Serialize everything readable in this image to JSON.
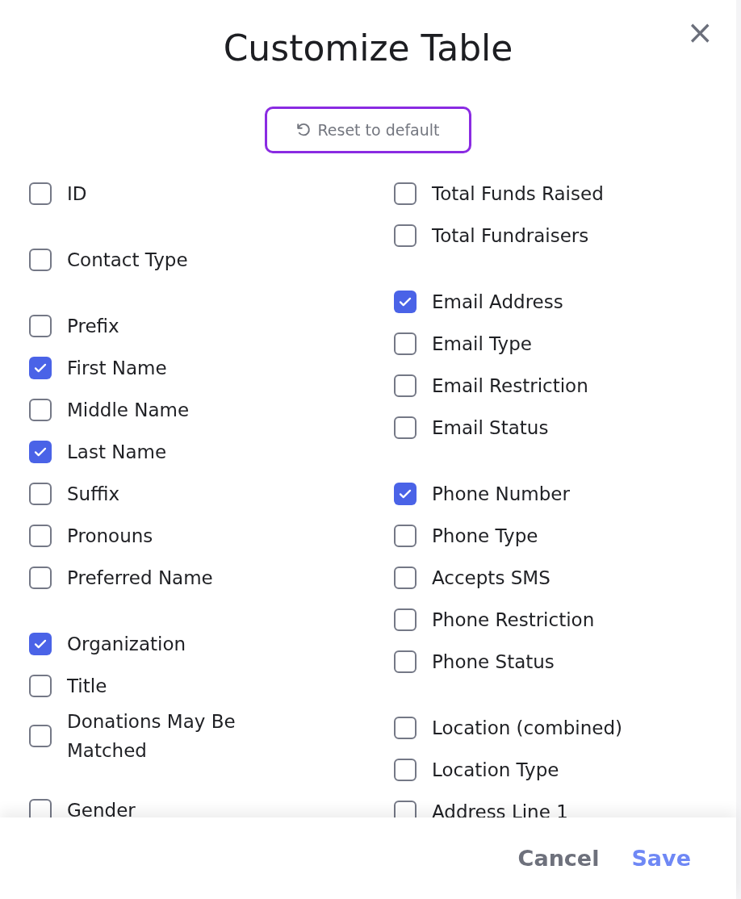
{
  "dialog": {
    "title": "Customize Table",
    "close": "×",
    "reset_button": "Reset to default",
    "columns": [
      {
        "groups": [
          {
            "items": [
              {
                "label": "ID",
                "checked": false
              }
            ]
          },
          {
            "items": [
              {
                "label": "Contact Type",
                "checked": false
              }
            ]
          },
          {
            "items": [
              {
                "label": "Prefix",
                "checked": false
              },
              {
                "label": "First Name",
                "checked": true
              },
              {
                "label": "Middle Name",
                "checked": false
              },
              {
                "label": "Last Name",
                "checked": true
              },
              {
                "label": "Suffix",
                "checked": false
              },
              {
                "label": "Pronouns",
                "checked": false
              },
              {
                "label": "Preferred Name",
                "checked": false
              }
            ]
          },
          {
            "items": [
              {
                "label": "Organization",
                "checked": true
              },
              {
                "label": "Title",
                "checked": false
              },
              {
                "label": "Donations May Be Matched",
                "checked": false
              }
            ]
          },
          {
            "items": [
              {
                "label": "Gender",
                "checked": false
              }
            ]
          }
        ]
      },
      {
        "groups": [
          {
            "items": [
              {
                "label": "Total Funds Raised",
                "checked": false
              },
              {
                "label": "Total Fundraisers",
                "checked": false
              }
            ]
          },
          {
            "items": [
              {
                "label": "Email Address",
                "checked": true
              },
              {
                "label": "Email Type",
                "checked": false
              },
              {
                "label": "Email Restriction",
                "checked": false
              },
              {
                "label": "Email Status",
                "checked": false
              }
            ]
          },
          {
            "items": [
              {
                "label": "Phone Number",
                "checked": true
              },
              {
                "label": "Phone Type",
                "checked": false
              },
              {
                "label": "Accepts SMS",
                "checked": false
              },
              {
                "label": "Phone Restriction",
                "checked": false
              },
              {
                "label": "Phone Status",
                "checked": false
              }
            ]
          },
          {
            "items": [
              {
                "label": "Location (combined)",
                "checked": false
              },
              {
                "label": "Location Type",
                "checked": false
              },
              {
                "label": "Address Line 1",
                "checked": false
              }
            ]
          }
        ]
      }
    ],
    "buttons": [
      {
        "label": "Cancel",
        "kind": "secondary"
      },
      {
        "label": "Save",
        "kind": "primary"
      }
    ]
  }
}
